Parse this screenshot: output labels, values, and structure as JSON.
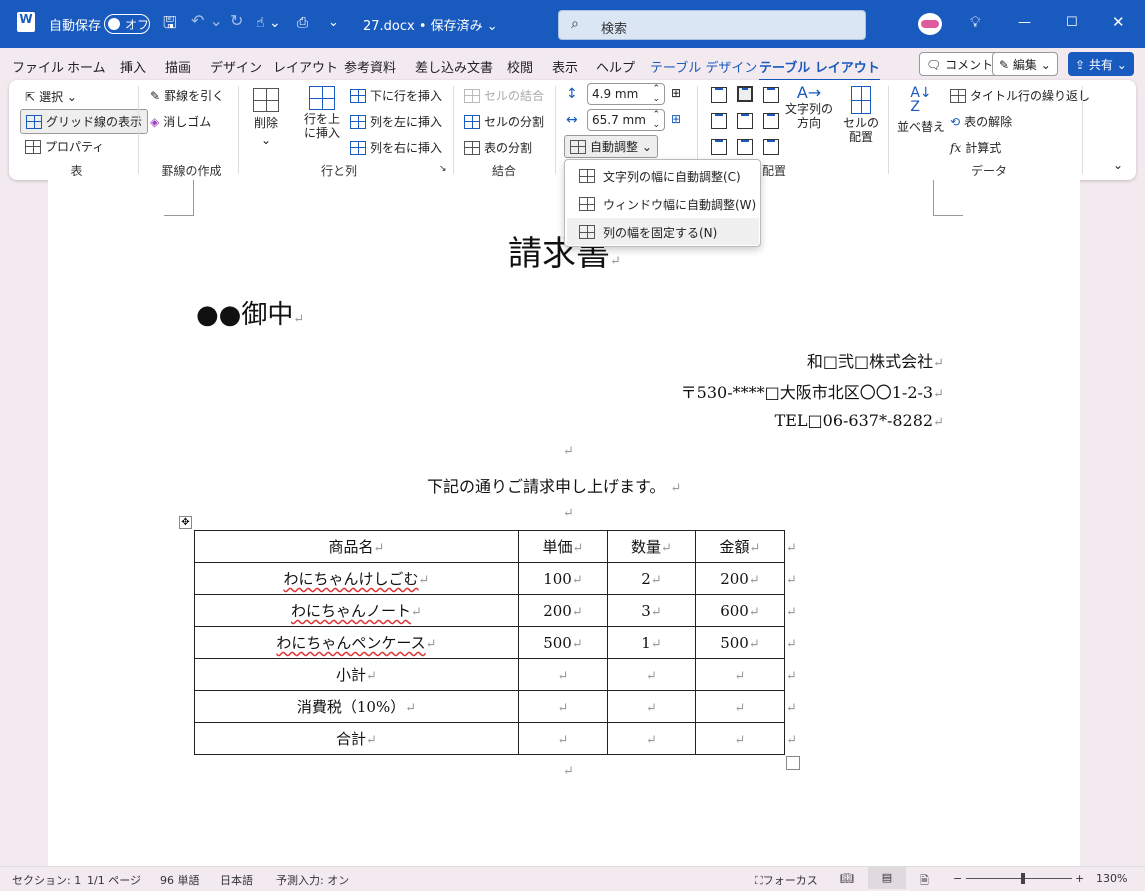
{
  "titlebar": {
    "autosave_label": "自動保存",
    "autosave_state": "オフ",
    "doc_title": "27.docx • 保存済み ⌄",
    "search_placeholder": "検索",
    "colors": {
      "bar": "#185abd"
    }
  },
  "tabs": [
    {
      "label": "ファイル"
    },
    {
      "label": "ホーム"
    },
    {
      "label": "挿入"
    },
    {
      "label": "描画"
    },
    {
      "label": "デザイン"
    },
    {
      "label": "レイアウト"
    },
    {
      "label": "参考資料"
    },
    {
      "label": "差し込み文書"
    },
    {
      "label": "校閲"
    },
    {
      "label": "表示"
    },
    {
      "label": "ヘルプ"
    },
    {
      "label": "テーブル デザイン"
    },
    {
      "label": "テーブル レイアウト",
      "selected": true
    }
  ],
  "topbuttons": {
    "comment": "コメント",
    "edit": "編集 ⌄",
    "share": "共有 ⌄"
  },
  "ribbon": {
    "table": {
      "select": "選択 ⌄",
      "gridlines": "グリッド線の表示",
      "properties": "プロパティ",
      "label": "表"
    },
    "draw": {
      "draw_borders": "罫線を引く",
      "eraser": "消しゴム",
      "label": "罫線の作成"
    },
    "rowscols": {
      "delete": "削除",
      "insert_above": "行を上\nに挿入",
      "insert_below": "下に行を挿入",
      "insert_left": "列を左に挿入",
      "insert_right": "列を右に挿入",
      "label": "行と列"
    },
    "merge": {
      "merge_cells": "セルの結合",
      "split_cells": "セルの分割",
      "split_table": "表の分割",
      "label": "結合"
    },
    "cellsize": {
      "height": "4.9 mm",
      "width": "65.7 mm",
      "autofit": "自動調整 ⌄"
    },
    "alignment": {
      "text_direction": "文字列の\n方向",
      "cell_margins": "セルの\n配置",
      "label": "配置"
    },
    "data": {
      "sort": "並べ替え",
      "repeat_header": "タイトル行の繰り返し",
      "convert": "表の解除",
      "formula": "計算式",
      "label": "データ"
    }
  },
  "autofit_menu": [
    {
      "label": "文字列の幅に自動調整(C)"
    },
    {
      "label": "ウィンドウ幅に自動調整(W)"
    },
    {
      "label": "列の幅を固定する(N)",
      "hovered": true
    }
  ],
  "document": {
    "title": "請求書",
    "recipient": "●●御中",
    "company": "和□弐□株式会社",
    "address": "〒530-****□大阪市北区〇〇1-2-3",
    "tel": "TEL□06-637*-8282",
    "intro": "下記の通りご請求申し上げます。",
    "mark": "↵",
    "table": {
      "headers": [
        "商品名",
        "単価",
        "数量",
        "金額"
      ],
      "rows": [
        [
          "わにちゃんけしごむ",
          "100",
          "2",
          "200"
        ],
        [
          "わにちゃんノート",
          "200",
          "3",
          "600"
        ],
        [
          "わにちゃんペンケース",
          "500",
          "1",
          "500"
        ],
        [
          "小計",
          "",
          "",
          ""
        ],
        [
          "消費税（10%）",
          "",
          "",
          ""
        ],
        [
          "合計",
          "",
          "",
          ""
        ]
      ]
    }
  },
  "status": {
    "section": "セクション: 1",
    "page": "1/1 ページ",
    "words": "96 単語",
    "lang": "日本語",
    "predict": "予測入力: オン",
    "focus": "フォーカス",
    "zoom": "130%",
    "zoom_percent": 130
  }
}
